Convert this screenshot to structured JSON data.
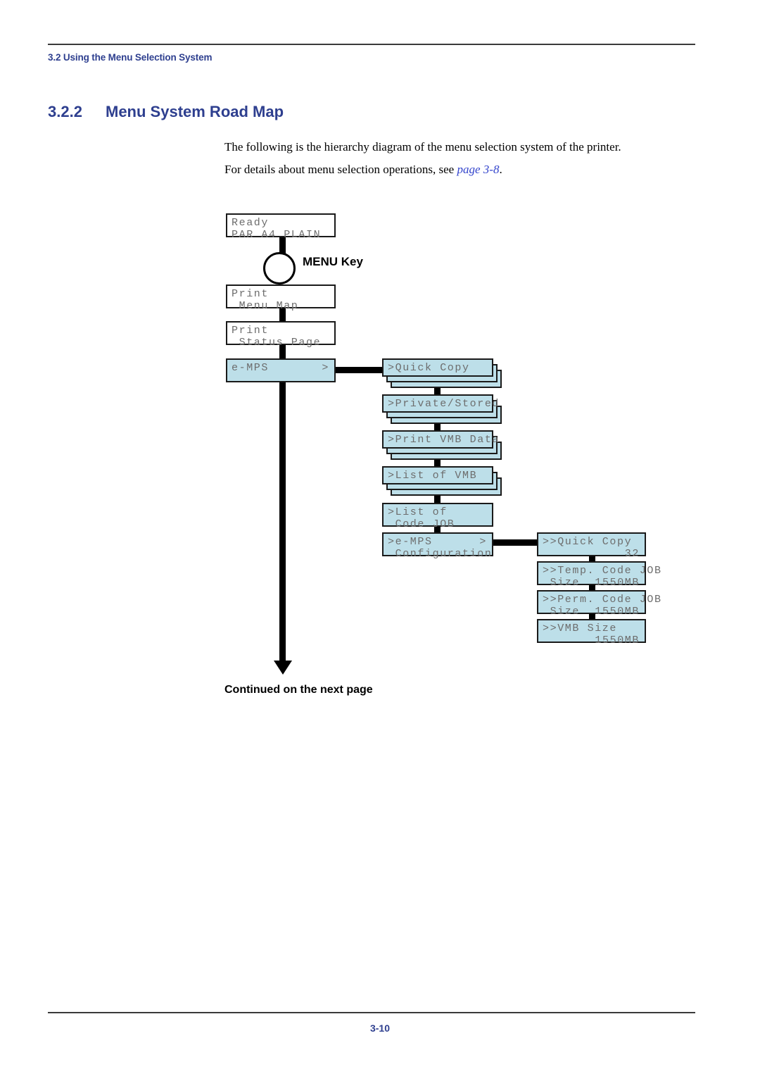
{
  "header": {
    "running_head": "3.2 Using the Menu Selection System"
  },
  "section": {
    "number": "3.2.2",
    "title": "Menu System Road Map"
  },
  "body": {
    "paragraph_1": "The following is the hierarchy diagram of the menu selection system of the printer.",
    "paragraph_2_prefix": "For details about menu selection operations, see ",
    "paragraph_2_xref": "page 3-8",
    "paragraph_2_suffix": "."
  },
  "diagram": {
    "menu_key_label": "MENU Key",
    "continued_label": "Continued on the next page",
    "colors": {
      "lcd_blue": "#bddfe9",
      "lcd_white": "#ffffff",
      "border": "#1a1a1a",
      "lcd_text": "#6d6d6d",
      "connector": "#000000"
    },
    "level0": [
      {
        "name": "ready",
        "line1": "Ready",
        "line2": "PAR A4 PLAIN",
        "style": "white",
        "stacked": false
      },
      {
        "name": "print-menu-map",
        "line1": "Print",
        "line2": " Menu Map",
        "style": "white",
        "stacked": false
      },
      {
        "name": "print-status-page",
        "line1": "Print",
        "line2": " Status Page",
        "style": "white",
        "stacked": false
      },
      {
        "name": "e-mps",
        "line1": "e-MPS",
        "line1_right": ">",
        "line2": "",
        "style": "blue",
        "stacked": false
      }
    ],
    "level1": [
      {
        "name": "quick-copy",
        "line1": ">Quick Copy",
        "line2": "",
        "style": "blue",
        "stacked": true
      },
      {
        "name": "private-stored",
        "line1": ">Private/Stored",
        "line2": "",
        "style": "blue",
        "stacked": true
      },
      {
        "name": "print-vmb-data",
        "line1": ">Print VMB Data",
        "line2": "",
        "style": "blue",
        "stacked": true
      },
      {
        "name": "list-of-vmb",
        "line1": ">List of VMB",
        "line2": "",
        "style": "blue",
        "stacked": true
      },
      {
        "name": "list-of-code-job",
        "line1": ">List of",
        "line2": " Code JOB",
        "style": "blue",
        "stacked": false
      },
      {
        "name": "e-mps-configuration",
        "line1": ">e-MPS",
        "line1_right": ">",
        "line2": " Configuration",
        "style": "blue",
        "stacked": false
      }
    ],
    "level2": [
      {
        "name": "quick-copy-count",
        "line1": ">>Quick Copy",
        "line2": "",
        "line2_right": "32",
        "style": "blue",
        "stacked": false
      },
      {
        "name": "temp-code-job-size",
        "line1": ">>Temp. Code JOB",
        "line2": " Size",
        "line2_right": "1550MB",
        "style": "blue",
        "stacked": false
      },
      {
        "name": "perm-code-job-size",
        "line1": ">>Perm. Code JOB",
        "line2": " Size",
        "line2_right": "1550MB",
        "style": "blue",
        "stacked": false
      },
      {
        "name": "vmb-size",
        "line1": ">>VMB Size",
        "line2": "",
        "line2_right": "1550MB",
        "style": "blue",
        "stacked": false
      }
    ]
  },
  "footer": {
    "page_number": "3-10"
  }
}
